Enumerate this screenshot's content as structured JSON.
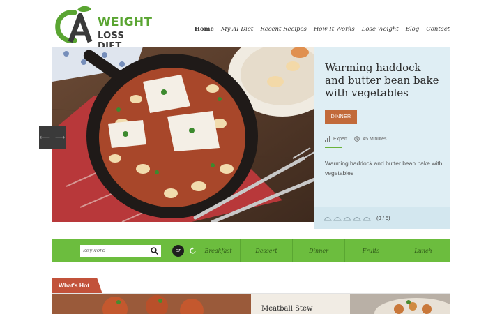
{
  "logo": {
    "line1": "WEIGHT",
    "line2": "LOSS DIET"
  },
  "nav": [
    "Home",
    "My AI Diet",
    "Recent Recipes",
    "How It Works",
    "Lose Weight",
    "Blog",
    "Contact"
  ],
  "hero": {
    "title": "Warming haddock and butter bean bake with vegetables",
    "badge": "DINNER",
    "difficulty": "Expert",
    "time": "45 Minutes",
    "description": "Warming haddock and butter bean bake with vegetables",
    "rating": "(0 / 5)",
    "rating_value": 0,
    "rating_max": 5
  },
  "search": {
    "placeholder": "keyword"
  },
  "or_label": "or",
  "categories": [
    "Breakfast",
    "Dessert",
    "Dinner",
    "Fruits",
    "Lunch"
  ],
  "whats_hot": {
    "label": "What's Hot",
    "card_title": "Meatball Stew"
  },
  "colors": {
    "brand_green": "#6cbd3e",
    "badge": "#c26a3a",
    "hot_tab": "#c2523a",
    "panel": "#dfeef4"
  }
}
